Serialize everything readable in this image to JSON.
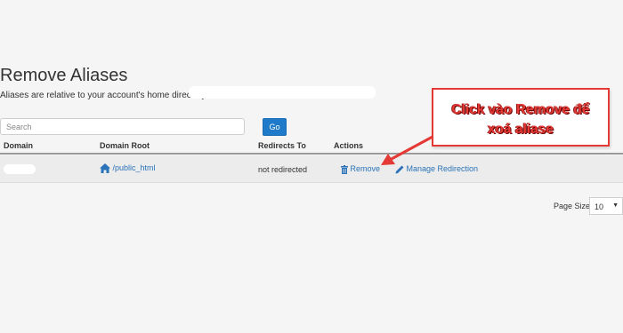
{
  "page": {
    "title": "Remove Aliases",
    "subtitle": "Aliases are relative to your account's home directory."
  },
  "search": {
    "placeholder": "Search",
    "go_label": "Go"
  },
  "table": {
    "columns": [
      "Domain",
      "Domain Root",
      "Redirects To",
      "Actions"
    ],
    "rows": [
      {
        "domain": "",
        "domain_root": "/public_html",
        "redirects_to": "not redirected",
        "remove_label": "Remove",
        "manage_label": "Manage Redirection"
      }
    ]
  },
  "pagination": {
    "page_size_label": "Page Size",
    "page_size_value": "10"
  },
  "annotation": {
    "line1": "Click vào Remove để",
    "line2": "xoá aliase",
    "color": "#e53935"
  },
  "colors": {
    "link": "#2a73b8",
    "primary_button": "#1f7bc9"
  },
  "icons": [
    "home-icon",
    "trash-icon",
    "pencil-icon",
    "caret-down-icon"
  ]
}
